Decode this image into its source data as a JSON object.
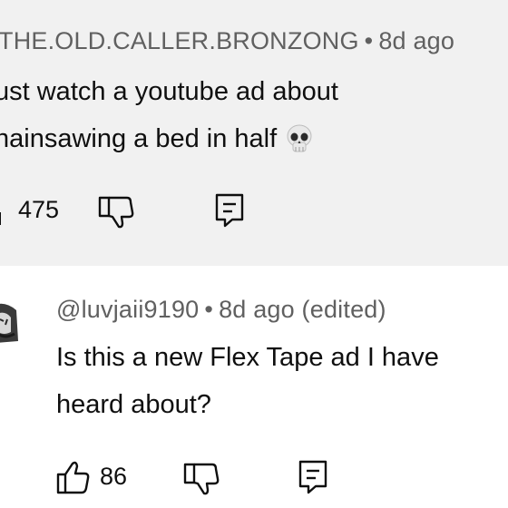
{
  "comments": [
    {
      "author": "THE.OLD.CALLER.BRONZONG",
      "separator": "•",
      "time": "8d ago",
      "lines": [
        "ust watch a youtube ad about",
        "hainsawing a bed in half"
      ],
      "emoji_icon": "skull-emoji-icon",
      "likes": "475"
    },
    {
      "author": "@luvjaii9190",
      "separator": "•",
      "time": "8d ago (edited)",
      "lines": [
        "Is this a new Flex Tape ad I have",
        "heard about?"
      ],
      "likes": "86"
    }
  ],
  "colors": {
    "highlight_bg": "#f1f1f1",
    "meta_text": "#606060",
    "body_text": "#0f0f0f"
  },
  "icons": [
    "like-icon",
    "dislike-icon",
    "reply-icon",
    "avatar"
  ]
}
